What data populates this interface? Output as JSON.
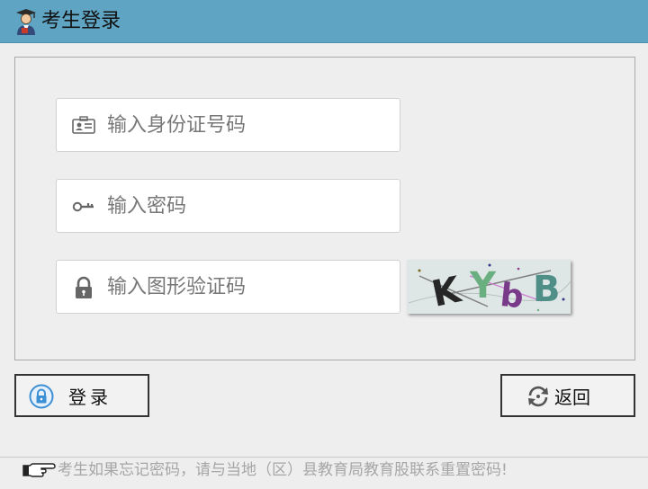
{
  "window": {
    "title": "考生登录",
    "title_icon": "graduate-user-icon",
    "header_color": "#5fa4c3"
  },
  "form": {
    "id_field": {
      "placeholder": "输入身份证号码",
      "value": "",
      "icon": "id-card-icon"
    },
    "password_field": {
      "placeholder": "输入密码",
      "value": "",
      "icon": "key-icon"
    },
    "captcha_field": {
      "placeholder": "输入图形验证码",
      "value": "",
      "icon": "lock-icon"
    },
    "captcha_image": {
      "text": "KYbB",
      "icon": "captcha-image"
    }
  },
  "buttons": {
    "login": {
      "label": "登录",
      "icon": "lock-circle-icon"
    },
    "back": {
      "label": "返回",
      "icon": "refresh-icon"
    }
  },
  "footer": {
    "notice": "考生如果忘记密码，请与当地（区）县教育局教育股联系重置密码!",
    "icon": "pointing-hand-icon"
  }
}
